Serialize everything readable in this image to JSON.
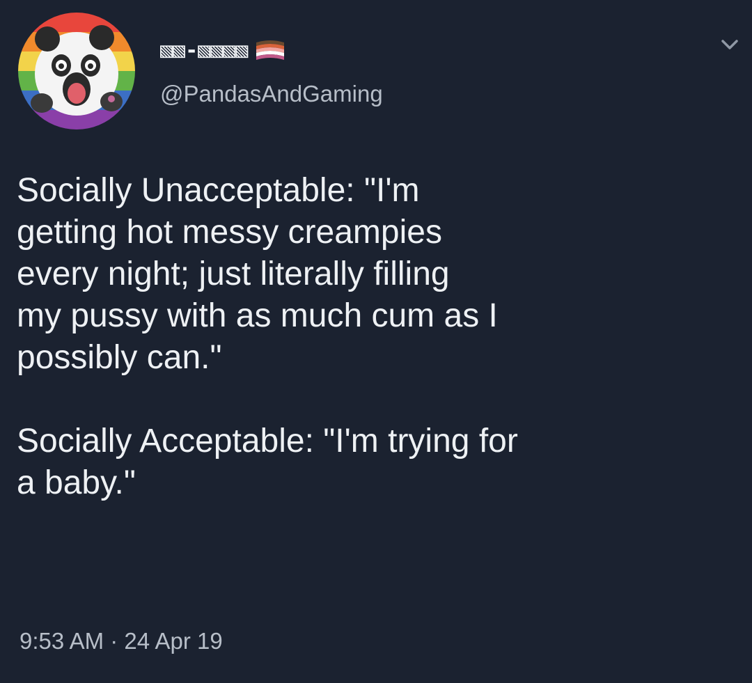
{
  "tweet": {
    "display_name": "▧▧-▧▧▧▧",
    "handle": "@PandasAndGaming",
    "paragraphs": [
      "Socially Unacceptable: \"I'm\ngetting hot messy creampies\nevery night; just literally filling\nmy pussy with as much cum as I\npossibly can.\"",
      "Socially Acceptable: \"I'm trying for\na baby.\""
    ],
    "timestamp": "9:53 AM · 24 Apr 19"
  },
  "icons": {
    "avatar": "panda-avatar-icon",
    "flag": "pride-flag-icon",
    "menu": "chevron-down-icon"
  },
  "colors": {
    "background": "#1b2230",
    "text": "#eef1f4",
    "secondary_text": "#b7bec8"
  }
}
